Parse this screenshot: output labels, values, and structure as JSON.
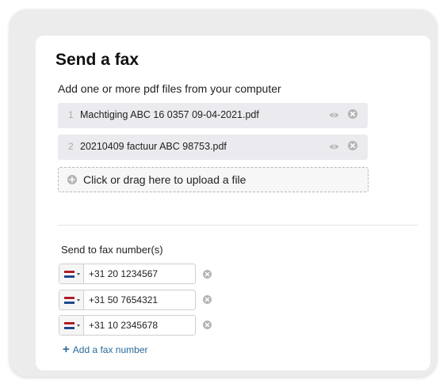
{
  "title": "Send a fax",
  "files": {
    "label": "Add one or more pdf files from your computer",
    "items": [
      {
        "num": "1",
        "name": "Machtiging ABC 16 0357 09-04-2021.pdf"
      },
      {
        "num": "2",
        "name": "20210409 factuur ABC 98753.pdf"
      }
    ],
    "upload_label": "Click or drag here to upload a file"
  },
  "fax": {
    "label": "Send to fax number(s)",
    "numbers": [
      {
        "country": "NL",
        "value": "+31 20 1234567"
      },
      {
        "country": "NL",
        "value": "+31 50 7654321"
      },
      {
        "country": "NL",
        "value": "+31 10 2345678"
      }
    ],
    "add_label": "Add a fax number"
  },
  "colors": {
    "link": "#2a6a9c",
    "file_row_bg": "#ebebef",
    "flag_red": "#ae1c28",
    "flag_white": "#ffffff",
    "flag_blue": "#21468b"
  },
  "icons": [
    "eye-icon",
    "remove-icon",
    "plus-circle-icon",
    "flag-nl-icon",
    "caret-down-icon",
    "plus-icon"
  ]
}
